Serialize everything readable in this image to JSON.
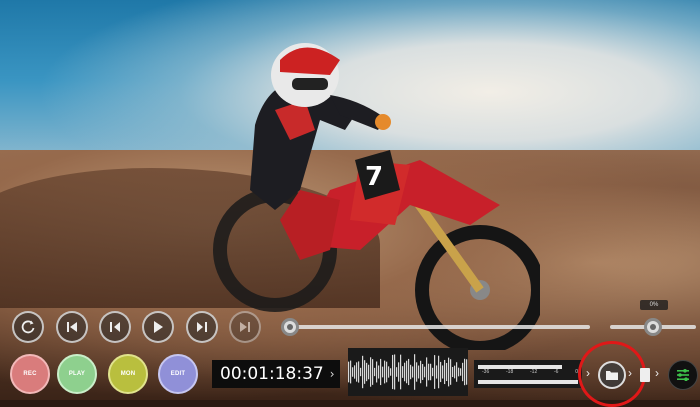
{
  "transport": {
    "buttons": [
      "loop-icon",
      "skip-start-icon",
      "step-back-icon",
      "play-icon",
      "step-forward-icon",
      "skip-end-icon"
    ]
  },
  "modes": {
    "rec": "REC",
    "play": "PLAY",
    "mon": "MON",
    "edit": "EDIT"
  },
  "timecode": {
    "value": "00:01:18:37",
    "chevron": "›"
  },
  "playback": {
    "position_fraction": 0.0
  },
  "volume": {
    "label": "0%",
    "level_fraction": 0.5
  },
  "meter": {
    "ticks": [
      "-36",
      "-18",
      "-12",
      "-6",
      "0"
    ]
  },
  "nav": {
    "chev1": "›",
    "chev2": "›",
    "chev3": "›"
  },
  "colors": {
    "rec": "#d97c7c",
    "play": "#8ed08e",
    "mon": "#b9bf3e",
    "edit": "#9090d8",
    "highlight_ring": "#e01818"
  }
}
